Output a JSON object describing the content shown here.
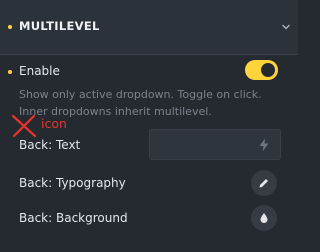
{
  "section": {
    "title": "MULTILEVEL",
    "icon": "chevron-down-icon"
  },
  "enable": {
    "label": "Enable",
    "value": true,
    "accent_color": "#ffd43b",
    "help": "Show only active dropdown. Toggle on click. Inner dropdowns inherit multilevel."
  },
  "annotation": {
    "text": "icon",
    "color": "#e8342c",
    "icon": "x-mark-icon"
  },
  "controls": [
    {
      "label": "Back: Text",
      "type": "text-input",
      "value": "",
      "icon": "bolt-icon"
    },
    {
      "label": "Back: Typography",
      "type": "button",
      "icon": "pencil-icon"
    },
    {
      "label": "Back: Background",
      "type": "button",
      "icon": "drop-icon"
    }
  ]
}
